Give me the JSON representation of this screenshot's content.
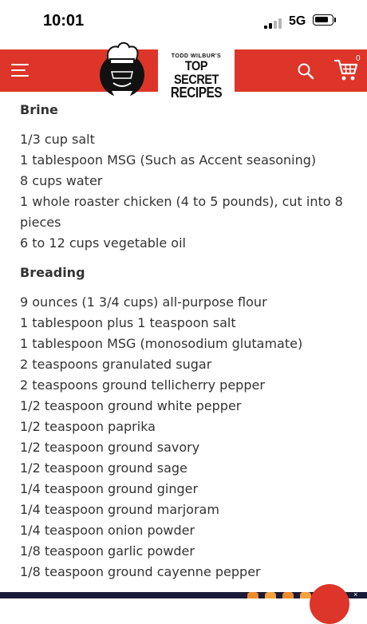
{
  "status_bar": {
    "time": "10:01",
    "network": "5G"
  },
  "nav": {
    "logo_top": "TODD WILBUR'S",
    "logo_mid": "TOP SECRET",
    "logo_bot": "RECIPES",
    "cart_count": "0",
    "accent_color": "#dd3529",
    "icons": [
      "menu-icon",
      "chef-logo",
      "search-icon",
      "cart-icon"
    ]
  },
  "sections": [
    {
      "heading": "Brine",
      "items": [
        "1/3 cup salt",
        "1 tablespoon MSG (Such as Accent seasoning)",
        "8 cups water",
        "1 whole roaster chicken (4 to 5 pounds), cut into 8 pieces",
        "6 to 12 cups vegetable oil"
      ]
    },
    {
      "heading": "Breading",
      "items": [
        "9 ounces (1 3/4 cups) all-purpose flour",
        "1 tablespoon plus 1 teaspoon salt",
        "1 tablespoon MSG (monosodium glutamate)",
        "2 teaspoons granulated sugar",
        "2 teaspoons ground tellicherry pepper",
        "1/2 teaspoon ground white pepper",
        "1/2 teaspoon paprika",
        "1/2 teaspoon ground savory",
        "1/2 teaspoon ground sage",
        "1/4 teaspoon ground ginger",
        "1/4 teaspoon ground marjoram",
        "1/4 teaspoon onion powder",
        "1/8 teaspoon garlic powder",
        "1/8 teaspoon ground cayenne pepper"
      ]
    }
  ]
}
